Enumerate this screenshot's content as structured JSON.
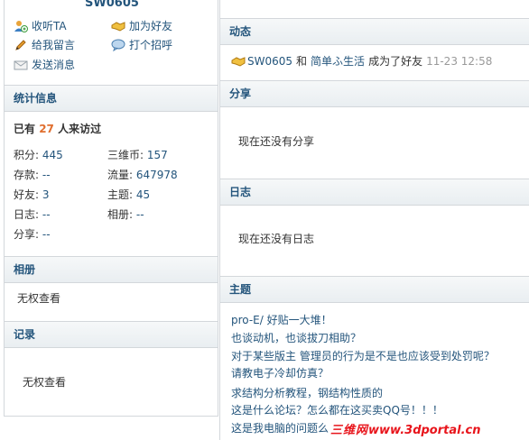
{
  "profile": {
    "username": "SW0605",
    "actions": {
      "follow": "收听TA",
      "add_friend": "加为好友",
      "leave_message": "给我留言",
      "greet": "打个招呼",
      "send_message": "发送消息"
    }
  },
  "stats": {
    "title": "统计信息",
    "visit_prefix": "已有",
    "visit_count": "27",
    "visit_suffix": "人来访过",
    "items": [
      {
        "label": "积分:",
        "value": "445"
      },
      {
        "label": "三维币:",
        "value": "157"
      },
      {
        "label": "存款:",
        "value": "--"
      },
      {
        "label": "流量:",
        "value": "647978"
      },
      {
        "label": "好友:",
        "value": "3"
      },
      {
        "label": "主题:",
        "value": "45"
      },
      {
        "label": "日志:",
        "value": "--"
      },
      {
        "label": "相册:",
        "value": "--"
      },
      {
        "label": "分享:",
        "value": "--"
      }
    ]
  },
  "album": {
    "title": "相册",
    "content": "无权查看"
  },
  "record": {
    "title": "记录",
    "content": "无权查看"
  },
  "activity": {
    "title": "动态",
    "user": "SW0605",
    "joiner": "和",
    "friend": "简单ふ生活",
    "action": "成为了好友",
    "time": "11-23 12:58"
  },
  "share": {
    "title": "分享",
    "content": "现在还没有分享"
  },
  "blog": {
    "title": "日志",
    "content": "现在还没有日志"
  },
  "topics": {
    "title": "主题",
    "items": [
      "pro-E/ 好贴一大堆！",
      "也谈动机，也谈拔刀相助？",
      "对于某些版主 管理员的行为是不是也应该受到处罚呢？",
      "请教电子冷却仿真？",
      "求结构分析教程，钢结构性质的",
      "这是什么论坛？怎么都在这买卖QQ号！！！",
      "这是我电脑的问题么"
    ]
  },
  "watermark": {
    "cn": "三维网",
    "url": "www.3dportal.cn"
  },
  "colors": {
    "link": "#24557c",
    "accent": "#e06f2f",
    "panel_border": "#d3d7db"
  }
}
